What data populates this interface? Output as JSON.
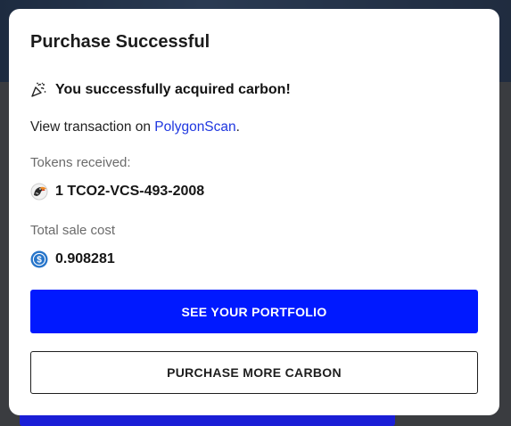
{
  "modal": {
    "title": "Purchase Successful",
    "success_message": "You successfully acquired carbon!",
    "transaction": {
      "prefix": "View transaction on ",
      "link_text": "PolygonScan",
      "suffix": "."
    },
    "tokens_received": {
      "label": "Tokens received:",
      "value": "1 TCO2-VCS-493-2008",
      "icon": "toucan-token-icon"
    },
    "total_sale_cost": {
      "label": "Total sale cost",
      "value": "0.908281",
      "icon": "usdc-icon"
    },
    "primary_button": "SEE YOUR PORTFOLIO",
    "secondary_button": "PURCHASE MORE CARBON"
  },
  "colors": {
    "primary": "#0019ff",
    "link": "#1f37e0",
    "usdc": "#2775ca"
  }
}
